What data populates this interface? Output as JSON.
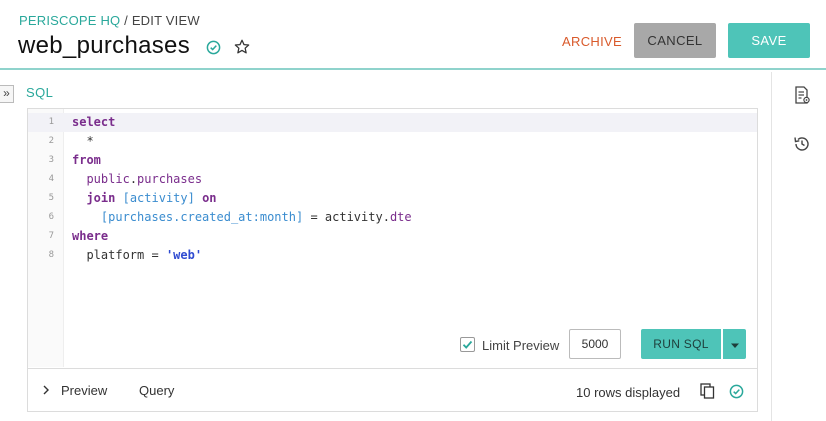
{
  "header": {
    "breadcrumb_org": "PERISCOPE HQ",
    "breadcrumb_sep": " / ",
    "breadcrumb_view": "EDIT VIEW",
    "title": "web_purchases",
    "archive_label": "ARCHIVE",
    "cancel_label": "CANCEL",
    "save_label": "SAVE"
  },
  "section": {
    "toggle": "»",
    "label": "SQL"
  },
  "editor": {
    "line_numbers": [
      "1",
      "2",
      "3",
      "4",
      "5",
      "6",
      "7",
      "8"
    ],
    "lines": [
      "select",
      "  *",
      "from",
      "  public.purchases",
      "  join [activity] on",
      "    [purchases.created_at:month] = activity.dte",
      "where",
      "  platform = 'web'"
    ]
  },
  "controls": {
    "limit_label": "Limit Preview",
    "limit_checked": true,
    "limit_value": "5000",
    "run_label": "RUN SQL"
  },
  "bottom": {
    "preview_label": "Preview",
    "query_label": "Query",
    "rows_label": "10 rows displayed"
  },
  "icons": {
    "status": "check-circle-icon",
    "favorite": "star-outline-icon",
    "rail_1": "document-settings-icon",
    "rail_2": "history-icon",
    "copy": "copy-icon"
  },
  "colors": {
    "accent": "#4ec4b8",
    "accent_text": "#2aa89b",
    "archive": "#d95a2b",
    "cancel_bg": "#a8a8a8",
    "keyword": "#7a2d8c",
    "table_ref": "#3a8ccf",
    "string": "#2f4bd1"
  }
}
